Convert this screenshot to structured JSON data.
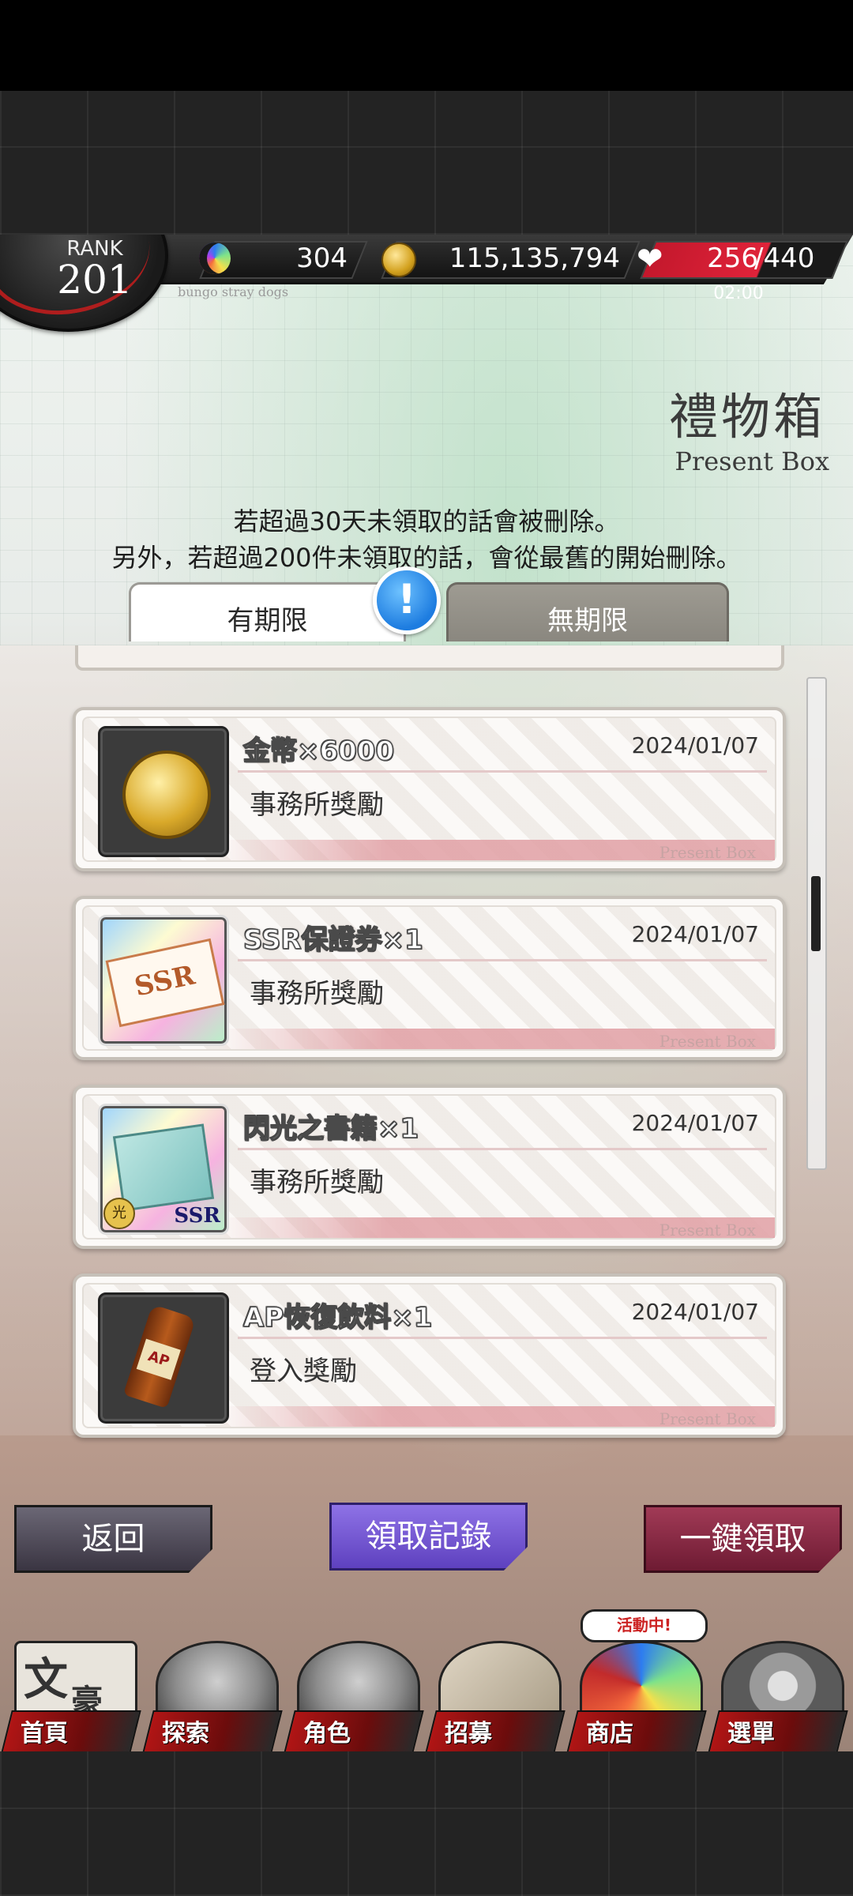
{
  "hud": {
    "rank_label": "RANK",
    "rank_value": "201",
    "subtitle": "bungo stray dogs",
    "gems": "304",
    "coins": "115,135,794",
    "ap_current": "256",
    "ap_max": "/440",
    "ap_timer": "02:00"
  },
  "page": {
    "title_jp": "禮物箱",
    "title_en": "Present Box",
    "notice_line1": "若超過30天未領取的話會被刪除。",
    "notice_line2": "另外，若超過200件未領取的話，會從最舊的開始刪除。"
  },
  "tabs": {
    "limited": "有期限",
    "unlimited": "無期限",
    "alert": "!"
  },
  "items": [
    {
      "name": "金幣×6000",
      "date": "2024/01/07",
      "source": "事務所獎勵",
      "icon": "gold-coin-icon"
    },
    {
      "name": "SSR保證券×1",
      "date": "2024/01/07",
      "source": "事務所獎勵",
      "icon": "ssr-ticket-icon"
    },
    {
      "name": "閃光之書籍×1",
      "date": "2024/01/07",
      "source": "事務所獎勵",
      "icon": "book-icon"
    },
    {
      "name": "AP恢復飲料×1",
      "date": "2024/01/07",
      "source": "登入獎勵",
      "icon": "ap-drink-icon"
    }
  ],
  "card_mark": "Present Box",
  "icon_text": {
    "ticket": "SSR",
    "ssr_badge": "SSR",
    "glow": "光",
    "ap": "AP"
  },
  "buttons": {
    "back": "返回",
    "history": "領取記錄",
    "claim_all": "一鍵領取"
  },
  "nav": {
    "home": "首頁",
    "explore": "探索",
    "characters": "角色",
    "recruit": "招募",
    "shop": "商店",
    "menu": "選單",
    "event_badge": "活動中!",
    "home_glyph": "文",
    "home_glyph2": "豪"
  },
  "colors": {
    "accent_red": "#c81d1d",
    "history_purple": "#6e52d3",
    "claim_maroon": "#8a2540"
  }
}
